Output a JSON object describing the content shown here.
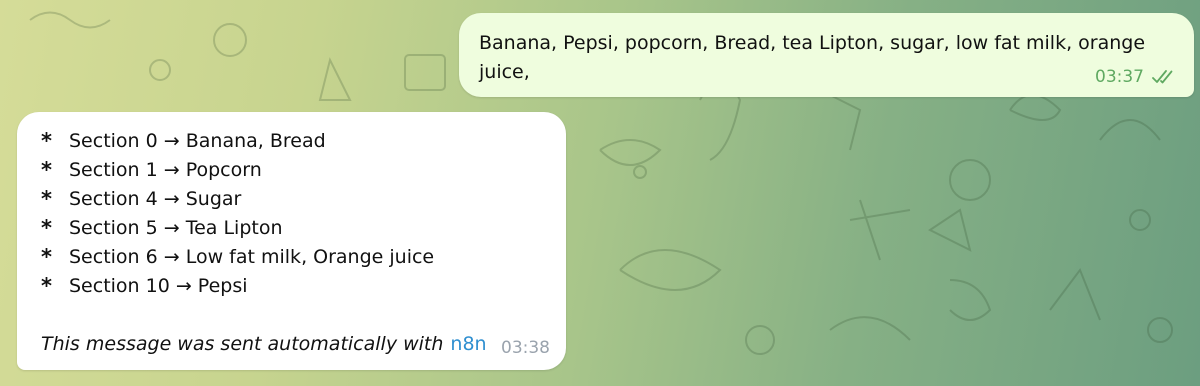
{
  "chat": {
    "outgoing": {
      "text": "Banana, Pepsi, popcorn, Bread, tea Lipton, sugar, low fat milk, orange juice,",
      "time": "03:37",
      "status_icon": "double-check-icon"
    },
    "incoming": {
      "bullet": "*",
      "items": [
        "Section 0 → Banana, Bread",
        "Section 1 → Popcorn",
        "Section 4 → Sugar",
        "Section 5 → Tea Lipton",
        "Section 6 → Low fat milk, Orange juice",
        "Section 10 → Pepsi"
      ],
      "footer_text": "This message was sent automatically with",
      "footer_link": "n8n",
      "time": "03:38"
    }
  },
  "colors": {
    "outgoing_bubble": "#effdde",
    "incoming_bubble": "#ffffff",
    "outgoing_time": "#5fa961",
    "link": "#2f8fd0"
  }
}
